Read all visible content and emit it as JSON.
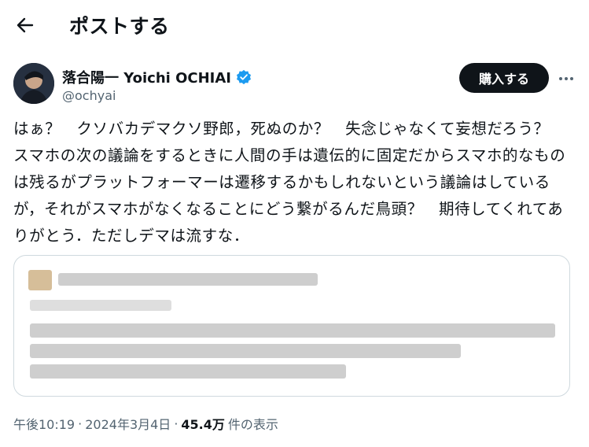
{
  "header": {
    "title": "ポストする"
  },
  "author": {
    "name": "落合陽一 Yoichi OCHIAI",
    "handle": "@ochyai"
  },
  "actions": {
    "buy_label": "購入する"
  },
  "post": {
    "text": "はぁ？　クソバカデマクソ野郎，死ぬのか？　失念じゃなくて妄想だろう？　スマホの次の議論をするときに人間の手は遺伝的に固定だからスマホ的なものは残るがプラットフォーマーは遷移するかもしれないという議論はしているが，それがスマホがなくなることにどう繋がるんだ鳥頭？　期待してくれてありがとう．ただしデマは流すな．"
  },
  "meta": {
    "time": "午後10:19",
    "sep1": "·",
    "date": "2024年3月4日",
    "sep2": "·",
    "views": "45.4万",
    "views_label": "件の表示"
  },
  "colors": {
    "text": "#0f1419",
    "secondary": "#536471",
    "verified": "#1d9bf0",
    "button": "#0f1419"
  },
  "icons": {
    "back": "arrow-left-icon",
    "verified": "verified-badge-icon",
    "more": "more-horizontal-icon"
  }
}
